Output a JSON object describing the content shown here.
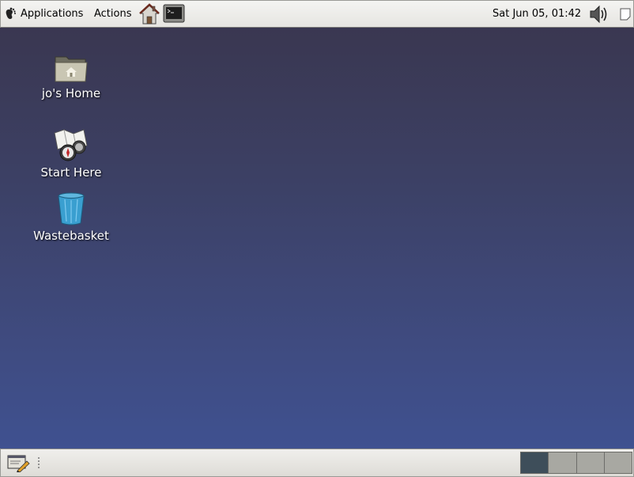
{
  "top_panel": {
    "gnome_icon": "gnome-foot-icon",
    "menus": {
      "applications": "Applications",
      "actions": "Actions"
    },
    "launchers": [
      "home-folder-icon",
      "terminal-icon"
    ],
    "clock": "Sat Jun 05, 01:42",
    "volume_icon": "speaker-volume-icon",
    "notify_icon": "notification-area-icon"
  },
  "desktop": {
    "icons": [
      {
        "label": "jo's Home",
        "icon": "home-folder-icon"
      },
      {
        "label": "Start Here",
        "icon": "map-compass-icon"
      },
      {
        "label": "Wastebasket",
        "icon": "trash-icon"
      }
    ]
  },
  "bottom_panel": {
    "show_desktop_icon": "show-desktop-icon",
    "workspaces": {
      "count": 4,
      "active_index": 0
    }
  },
  "colors": {
    "desktop_top": "#3a3751",
    "desktop_bottom": "#3f5190",
    "panel": "#ecebe7",
    "active_workspace": "#3e4e5a",
    "inactive_workspace": "#a8a8a2"
  }
}
